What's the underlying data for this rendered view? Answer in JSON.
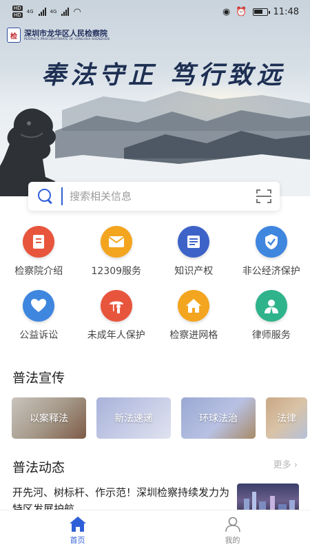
{
  "status_bar": {
    "left_labels": [
      "HD",
      "HD"
    ],
    "signal_labels": [
      "4G",
      "4G"
    ],
    "time": "11:48"
  },
  "header": {
    "org_name_cn": "深圳市龙华区人民检察院",
    "org_name_en": "PEOPLE'S PROCURATORATE OF LONGHUA SHENZHEN",
    "slogan": "奉法守正 笃行致远"
  },
  "search": {
    "placeholder": "搜索相关信息"
  },
  "services": [
    {
      "label": "检察院介绍",
      "icon": "procuratorate-intro-icon",
      "color": "#e8553d"
    },
    {
      "label": "12309服务",
      "icon": "envelope-icon",
      "color": "#f3a51f"
    },
    {
      "label": "知识产权",
      "icon": "document-icon",
      "color": "#3d63c9"
    },
    {
      "label": "非公经济保护",
      "icon": "shield-check-icon",
      "color": "#3f86df"
    },
    {
      "label": "公益诉讼",
      "icon": "heart-hand-icon",
      "color": "#3f86df"
    },
    {
      "label": "未成年人保护",
      "icon": "child-umbrella-icon",
      "color": "#e8553d"
    },
    {
      "label": "检察进网格",
      "icon": "house-icon",
      "color": "#f3a51f"
    },
    {
      "label": "律师服务",
      "icon": "lawyer-icon",
      "color": "#2fb38b"
    }
  ],
  "sections": {
    "publicity_title": "普法宣传",
    "news_title": "普法动态",
    "more_label": "更多"
  },
  "publicity_cards": [
    {
      "label": "以案释法"
    },
    {
      "label": "新法速递"
    },
    {
      "label": "环球法治"
    },
    {
      "label": "法律"
    }
  ],
  "news": {
    "headline": "开先河、树标杆、作示范！深圳检察持续发力为特区发展护航"
  },
  "bottom_nav": {
    "home_label": "首页",
    "mine_label": "我的"
  },
  "colors": {
    "accent": "#2f5fd8"
  }
}
